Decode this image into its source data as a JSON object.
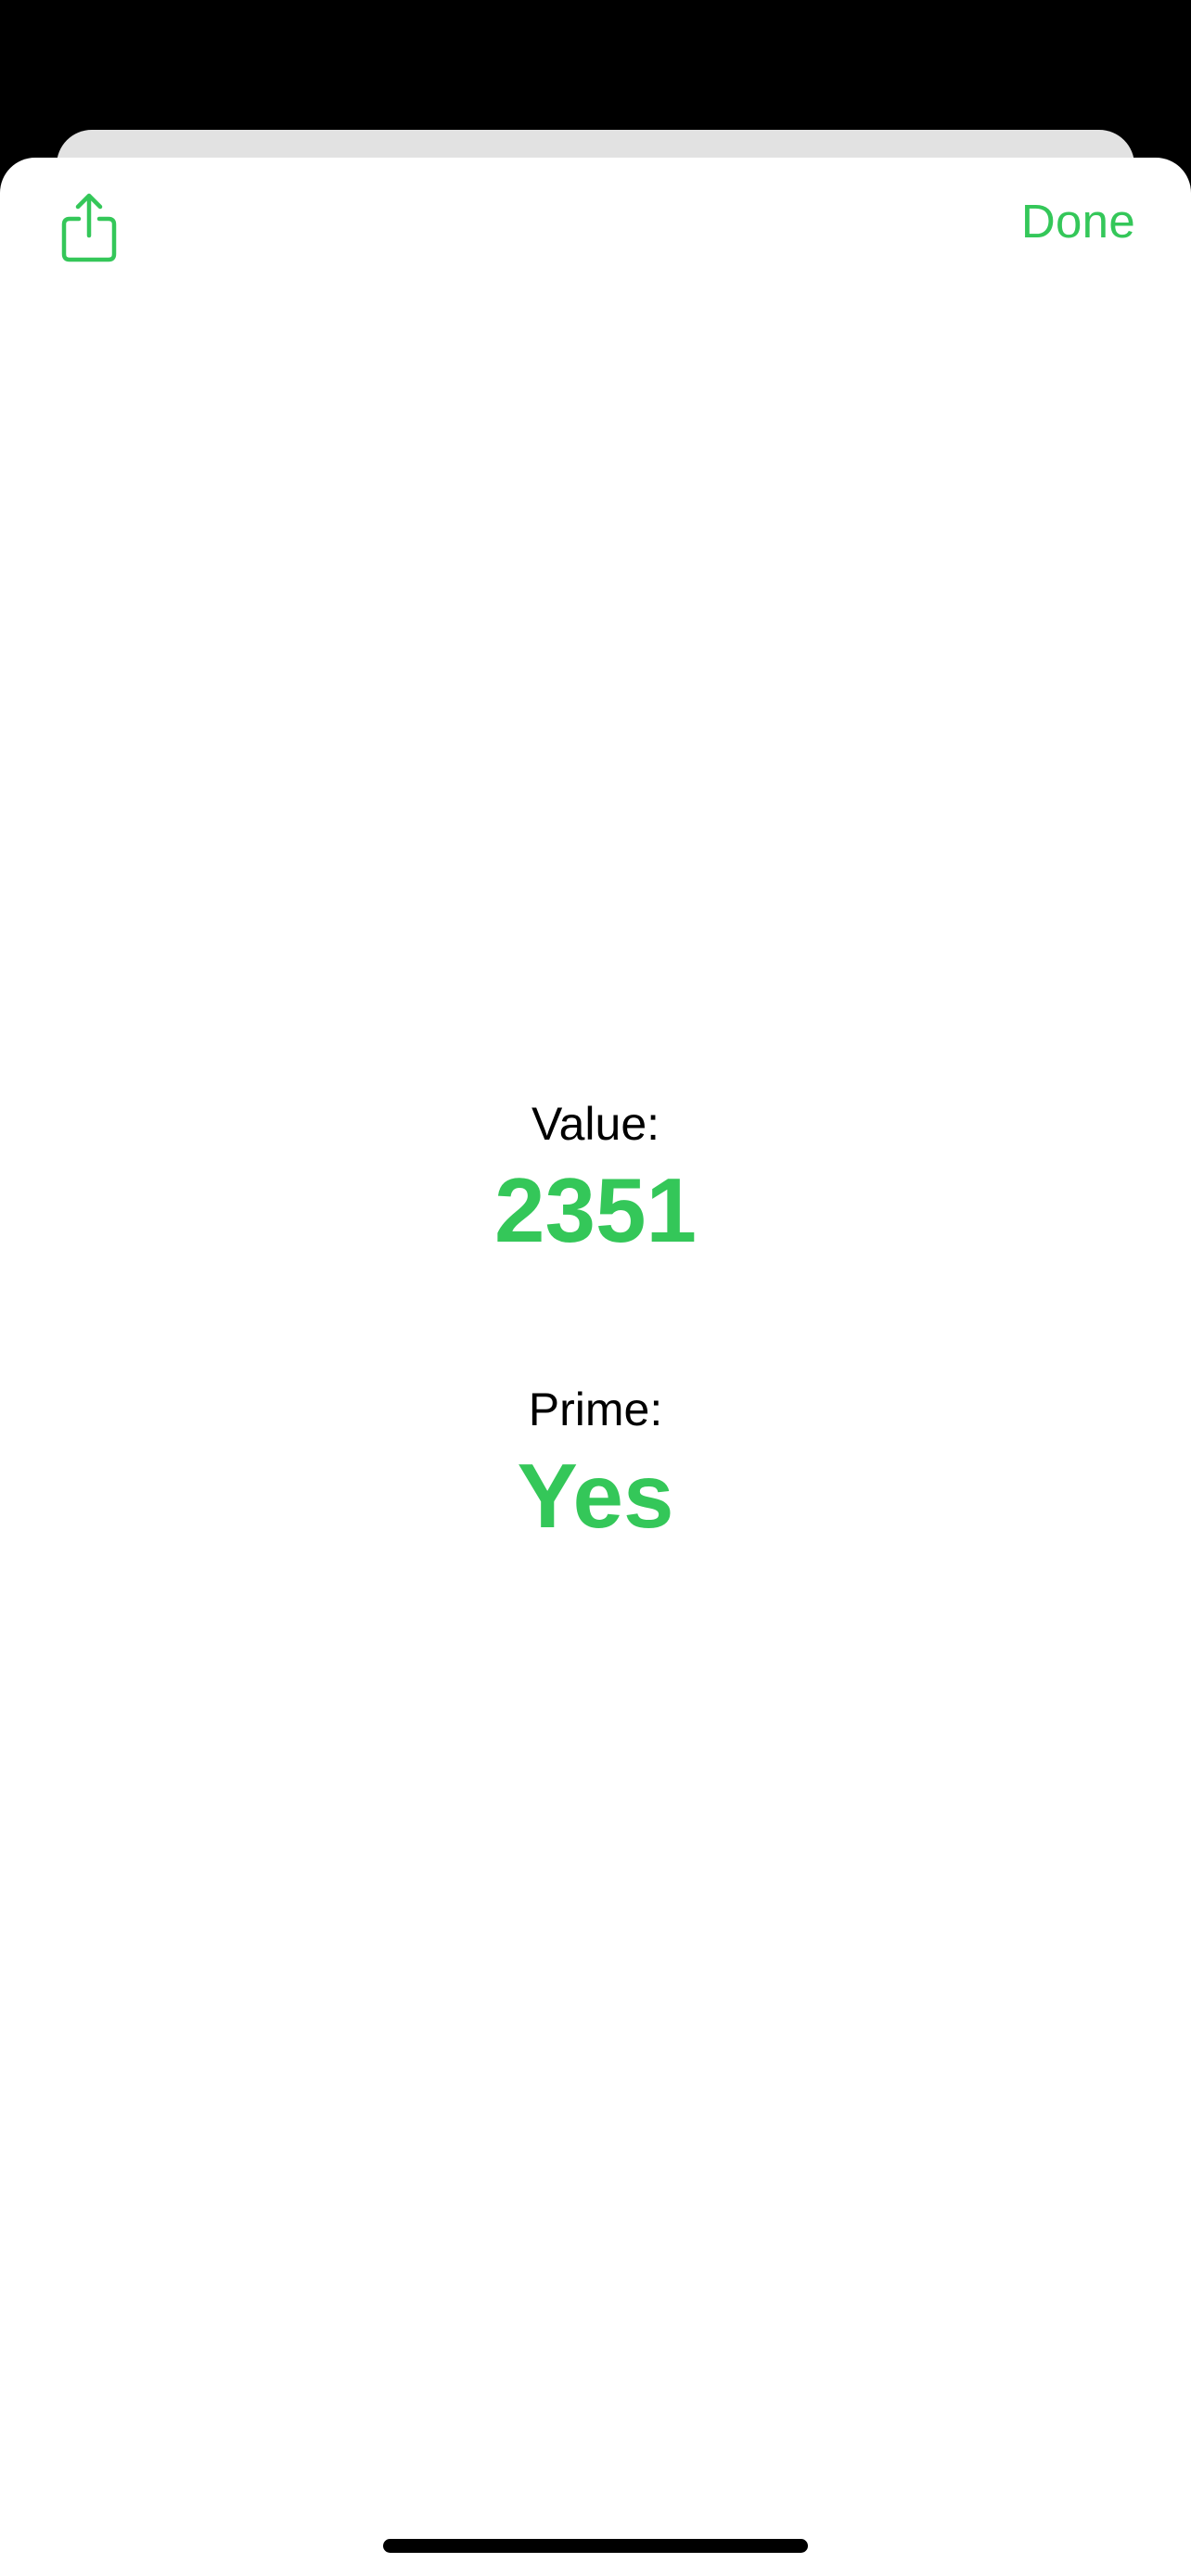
{
  "toolbar": {
    "share_icon": "share-icon",
    "done_label": "Done"
  },
  "result": {
    "value_label": "Value:",
    "value": "2351",
    "prime_label": "Prime:",
    "prime": "Yes"
  },
  "colors": {
    "accent": "#34c759",
    "background": "#ffffff",
    "backdrop": "#000000",
    "back_card": "#e2e2e2"
  }
}
